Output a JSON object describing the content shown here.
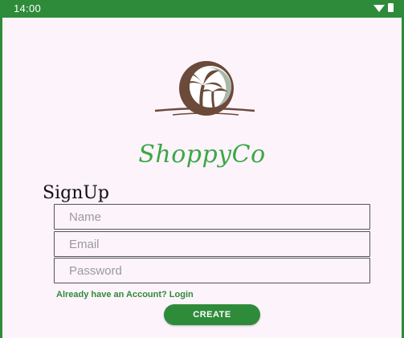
{
  "status_bar": {
    "time": "14:00",
    "icons": [
      "wifi-icon",
      "battery-icon"
    ],
    "color": "#2e8b3a"
  },
  "logo": {
    "icon": "palm-tree-coconut-logo",
    "colors": [
      "#6b4a3a",
      "#9aa89a"
    ]
  },
  "brand": {
    "name": "ShoppyCo",
    "color": "#3aa845"
  },
  "form": {
    "title": "SignUp",
    "name_placeholder": "Name",
    "email_placeholder": "Email",
    "password_placeholder": "Password",
    "login_link": "Already have an Account? Login",
    "create_label": "CREATE"
  },
  "colors": {
    "accent": "#2e8b3a",
    "background": "#fdf3fb"
  }
}
